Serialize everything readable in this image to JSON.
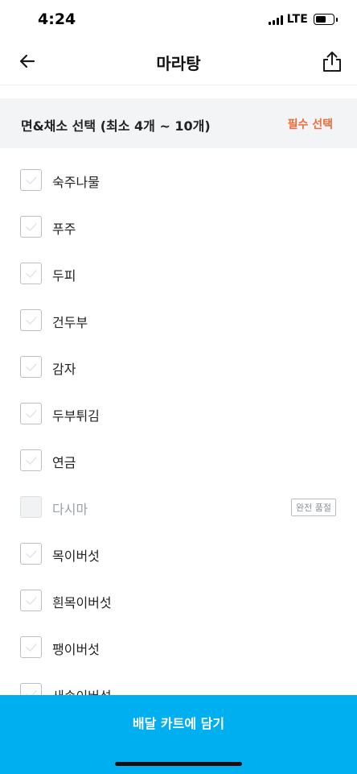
{
  "status_bar": {
    "time": "4:24",
    "network": "LTE",
    "icons": [
      "signal-icon",
      "battery-icon"
    ]
  },
  "nav": {
    "title": "마라탕",
    "back_icon": "back-arrow-icon",
    "share_icon": "share-icon"
  },
  "section": {
    "title": "면&채소 선택 (최소 4개 ~ 10개)",
    "required_label": "필수 선택",
    "required_color": "#f26b3a"
  },
  "options": [
    {
      "label": "숙주나물",
      "sold_out": false
    },
    {
      "label": "푸주",
      "sold_out": false
    },
    {
      "label": "두피",
      "sold_out": false
    },
    {
      "label": "건두부",
      "sold_out": false
    },
    {
      "label": "감자",
      "sold_out": false
    },
    {
      "label": "두부튀김",
      "sold_out": false
    },
    {
      "label": "연금",
      "sold_out": false
    },
    {
      "label": "다시마",
      "sold_out": true,
      "badge": "완전 품절"
    },
    {
      "label": "목이버섯",
      "sold_out": false
    },
    {
      "label": "흰목이버섯",
      "sold_out": false
    },
    {
      "label": "팽이버섯",
      "sold_out": false
    },
    {
      "label": "새송이버섯",
      "sold_out": false
    }
  ],
  "cta": {
    "label": "배달 카트에 담기",
    "color": "#00aff0"
  }
}
